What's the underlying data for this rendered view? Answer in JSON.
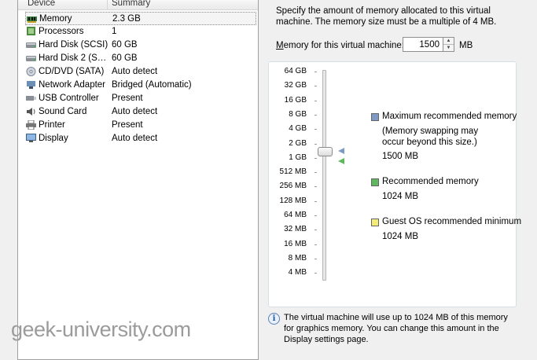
{
  "device_list": {
    "header_device": "Device",
    "header_summary": "Summary",
    "rows": [
      {
        "name": "Memory",
        "summary": "2.3 GB",
        "icon": "memory-icon"
      },
      {
        "name": "Processors",
        "summary": "1",
        "icon": "processor-icon"
      },
      {
        "name": "Hard Disk (SCSI)",
        "summary": "60 GB",
        "icon": "hard-disk-icon"
      },
      {
        "name": "Hard Disk 2 (S…",
        "summary": "60 GB",
        "icon": "hard-disk-icon"
      },
      {
        "name": "CD/DVD (SATA)",
        "summary": "Auto detect",
        "icon": "cd-dvd-icon"
      },
      {
        "name": "Network Adapter",
        "summary": "Bridged (Automatic)",
        "icon": "network-adapter-icon"
      },
      {
        "name": "USB Controller",
        "summary": "Present",
        "icon": "usb-icon"
      },
      {
        "name": "Sound Card",
        "summary": "Auto detect",
        "icon": "sound-card-icon"
      },
      {
        "name": "Printer",
        "summary": "Present",
        "icon": "printer-icon"
      },
      {
        "name": "Display",
        "summary": "Auto detect",
        "icon": "display-icon"
      }
    ]
  },
  "memory": {
    "description": "Specify the amount of memory allocated to this virtual machine. The memory size must be a multiple of 4 MB.",
    "label_prefix": "",
    "label_underlined": "M",
    "label_rest": "emory for this virtual machine:",
    "value": "1500",
    "unit": "MB",
    "slider_ticks": [
      "64 GB",
      "32 GB",
      "16 GB",
      "8 GB",
      "4 GB",
      "2 GB",
      "1 GB",
      "512 MB",
      "256 MB",
      "128 MB",
      "64 MB",
      "32 MB",
      "16 MB",
      "8 MB",
      "4 MB"
    ],
    "slider_value_mb": 1500
  },
  "legend": {
    "max_title": "Maximum recommended memory",
    "max_note": "(Memory swapping may occur beyond this size.)",
    "max_value": "1500 MB",
    "rec_title": "Recommended memory",
    "rec_value": "1024 MB",
    "min_title": "Guest OS recommended minimum",
    "min_value": "1024 MB",
    "colors": {
      "max": "#7d9ac7",
      "rec": "#5cb85c",
      "min": "#f3ec7a"
    }
  },
  "info": {
    "text": "The virtual machine will use up to 1024 MB of this memory for graphics memory. You can change this amount in the Display settings page.",
    "icon": "info-icon"
  },
  "watermark": "geek-university.com"
}
